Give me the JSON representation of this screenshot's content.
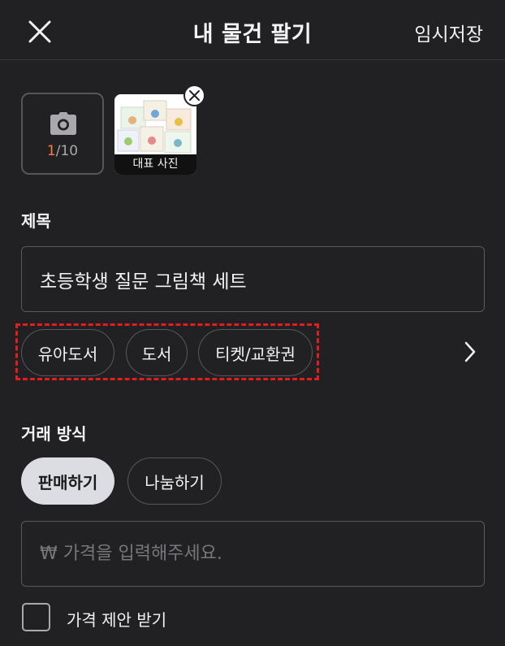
{
  "header": {
    "title": "내 물건 팔기",
    "save_draft": "임시저장",
    "close_icon": "close-icon"
  },
  "photos": {
    "count_current": "1",
    "count_total": "/10",
    "camera_icon": "camera-icon",
    "representative_label": "대표 사진",
    "remove_icon": "close-icon"
  },
  "title_section": {
    "label": "제목",
    "value": "초등학생 질문 그림책 세트"
  },
  "categories": {
    "items": [
      "유아도서",
      "도서",
      "티켓/교환권"
    ],
    "more_icon": "chevron-right-icon",
    "highlight_color": "#e01e1e"
  },
  "trade": {
    "label": "거래 방식",
    "options": [
      "판매하기",
      "나눔하기"
    ],
    "selected": "판매하기",
    "price_placeholder": "₩ 가격을 입력해주세요.",
    "offer_checkbox_label": "가격 제안 받기"
  },
  "colors": {
    "background": "#212123",
    "accent": "#ff7a3d"
  }
}
